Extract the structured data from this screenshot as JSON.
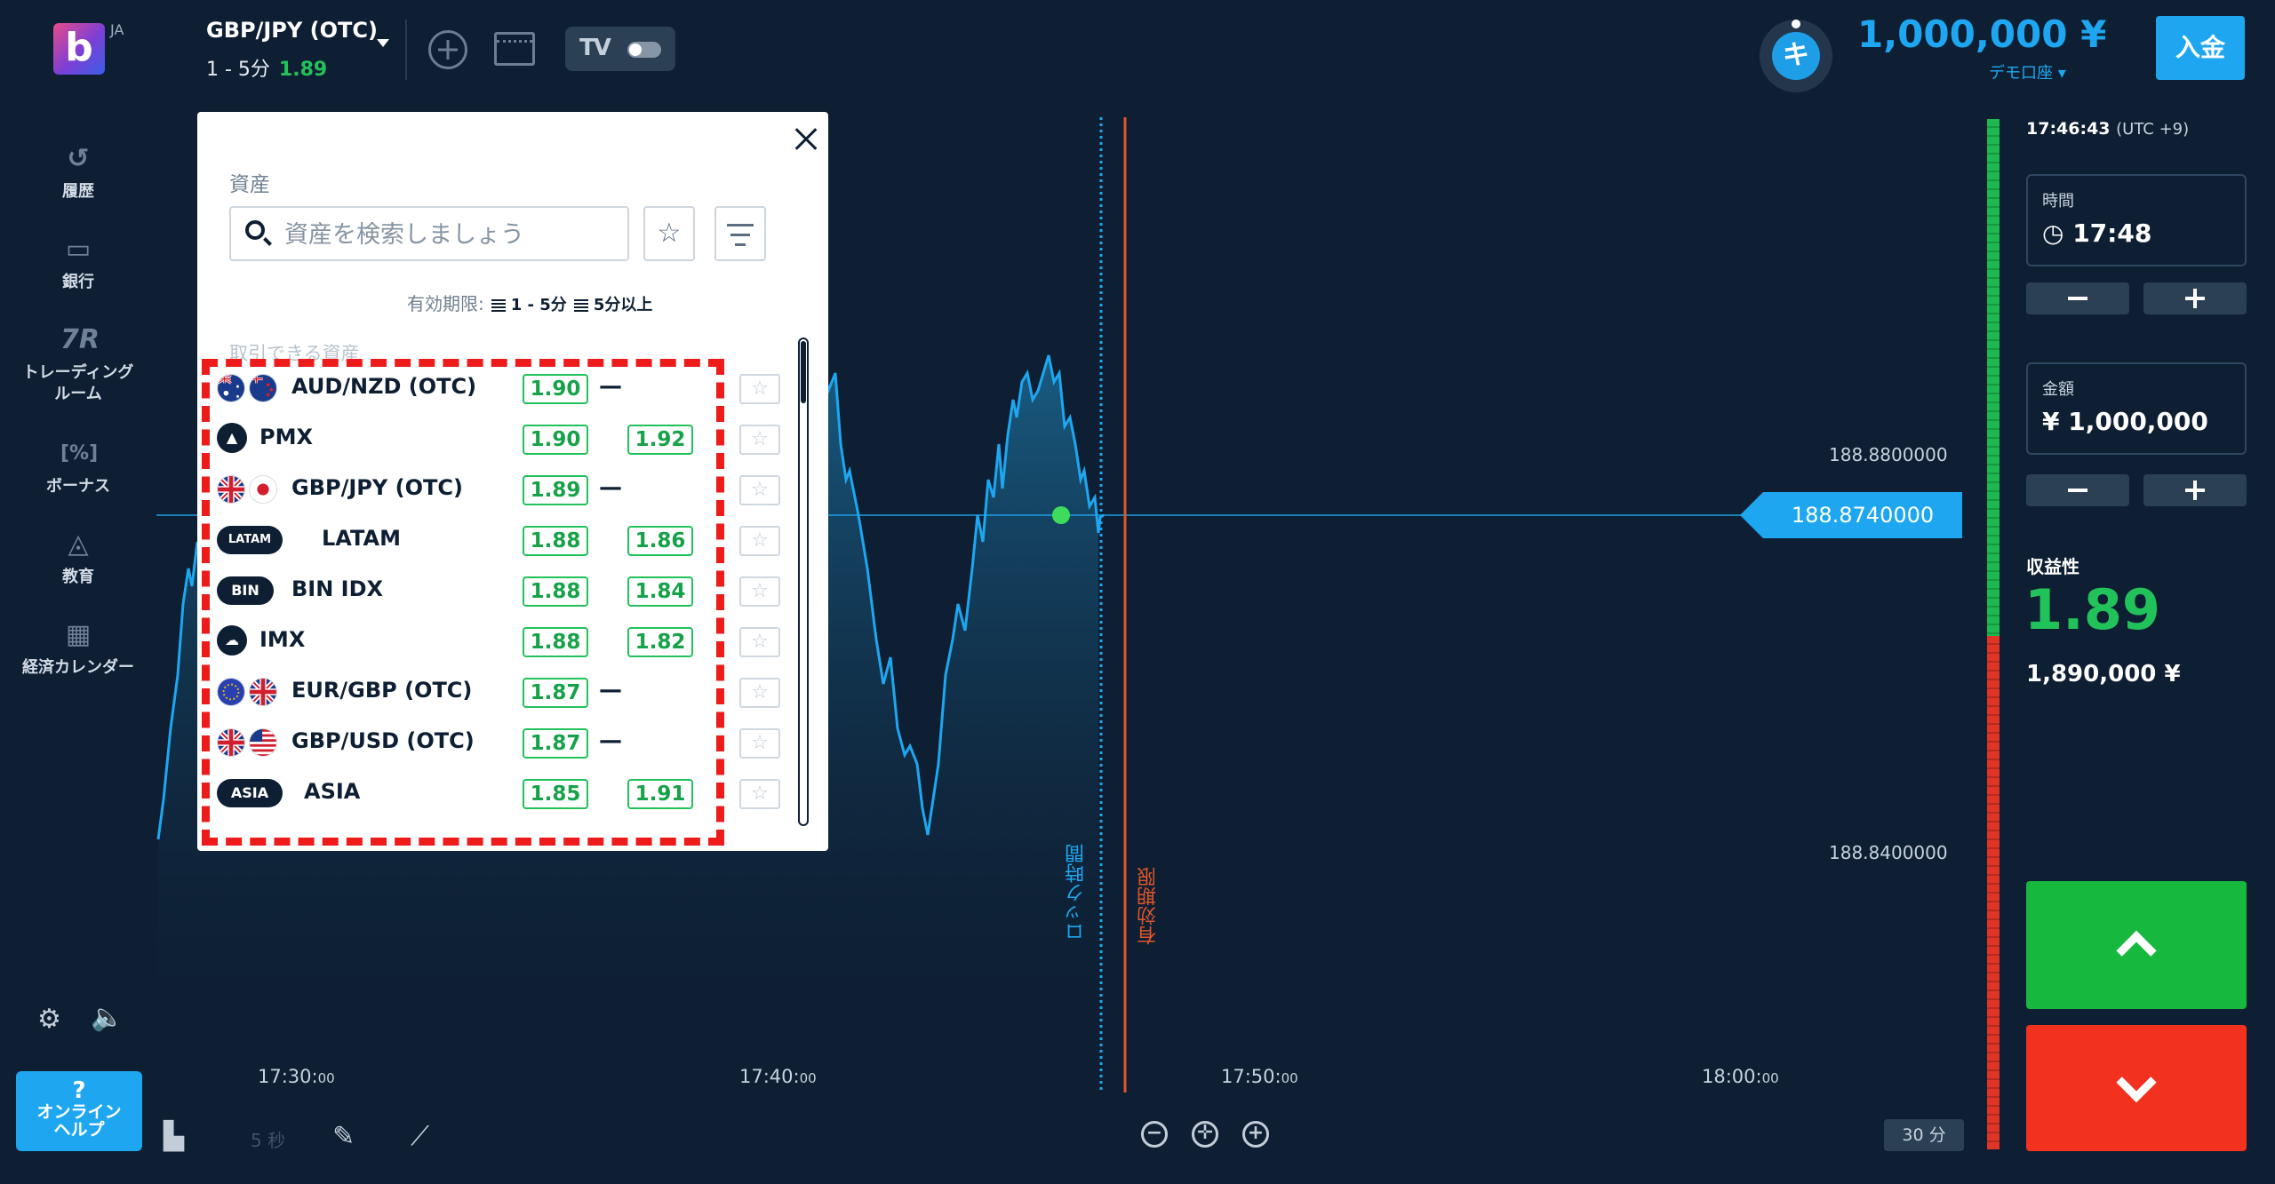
{
  "header": {
    "lang": "JA",
    "logo_letter": "b",
    "pair": "GBP/JPY (OTC)",
    "timeframe": "1 - 5分",
    "payout": "1.89",
    "tv_label": "TV",
    "balance": "1,000,000 ¥",
    "account_type": "デモ口座 ▾",
    "avatar_letter": "キ",
    "deposit_label": "入金"
  },
  "sidebar": {
    "items": [
      {
        "label": "履歴",
        "icon": "history-icon"
      },
      {
        "label": "銀行",
        "icon": "wallet-icon"
      },
      {
        "label": "トレーディング\nルーム",
        "icon": "trading-room-icon"
      },
      {
        "label": "ボーナス",
        "icon": "bonus-icon"
      },
      {
        "label": "教育",
        "icon": "education-icon"
      },
      {
        "label": "経済カレンダー",
        "icon": "calendar-icon"
      }
    ],
    "help_q": "?",
    "help_line1": "オンライン",
    "help_line2": "ヘルプ"
  },
  "chart": {
    "current_price": "188.8740000",
    "price_labels": [
      "188.8800000",
      "188.8400000"
    ],
    "time_labels": [
      {
        "main": "17:30:",
        "small": "00"
      },
      {
        "main": "17:40:",
        "small": "00"
      },
      {
        "main": "17:50:",
        "small": "00"
      },
      {
        "main": "18:00:",
        "small": "00"
      }
    ],
    "lock_label": "ロック時間",
    "expiry_label": "有効期限",
    "interval": "30 分",
    "five_sec": "5 秒",
    "line_color": "#1ea7f0"
  },
  "right_panel": {
    "clock": "17:46:43",
    "tz": "(UTC +9)",
    "time_caption": "時間",
    "time_value": "17:48",
    "amount_caption": "金額",
    "amount_value": "¥ 1,000,000",
    "profit_caption": "収益性",
    "profit_value": "1.89",
    "profit_amount": "1,890,000 ¥"
  },
  "popup": {
    "title": "資産",
    "search_placeholder": "資産を検索しましょう",
    "expiry_caption": "有効期限:",
    "expiry_short": "1 - 5分",
    "expiry_long": "5分以上",
    "section_label": "取引できる資産",
    "assets": [
      {
        "name": "AUD/NZD (OTC)",
        "short": "1.90",
        "long": "—"
      },
      {
        "name": "PMX",
        "short": "1.90",
        "long": "1.92"
      },
      {
        "name": "GBP/JPY (OTC)",
        "short": "1.89",
        "long": "—"
      },
      {
        "name": "LATAM",
        "badge": "LATAM",
        "short": "1.88",
        "long": "1.86"
      },
      {
        "name": "BIN IDX",
        "badge": "BIN",
        "short": "1.88",
        "long": "1.84"
      },
      {
        "name": "IMX",
        "short": "1.88",
        "long": "1.82"
      },
      {
        "name": "EUR/GBP (OTC)",
        "short": "1.87",
        "long": "—"
      },
      {
        "name": "GBP/USD (OTC)",
        "short": "1.87",
        "long": "—"
      },
      {
        "name": "ASIA",
        "badge": "ASIA",
        "short": "1.85",
        "long": "1.91"
      }
    ]
  }
}
